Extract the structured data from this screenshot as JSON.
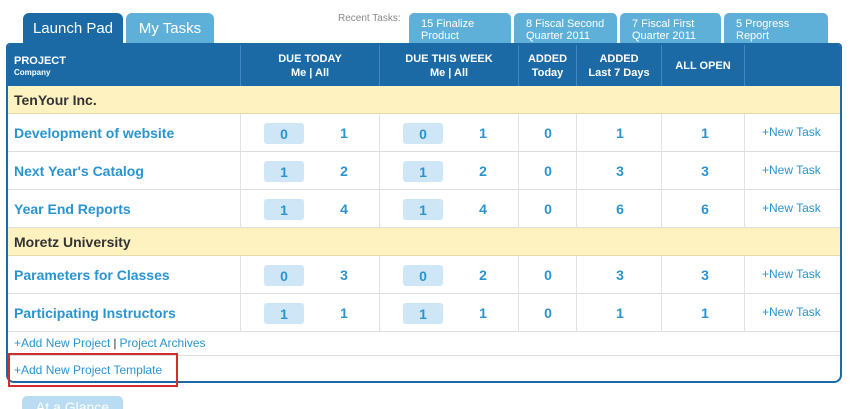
{
  "tabs": {
    "launch_pad": "Launch Pad",
    "my_tasks": "My Tasks"
  },
  "recent": {
    "label": "Recent Tasks:",
    "items": [
      {
        "line1": "15 Finalize",
        "line2": "Product"
      },
      {
        "line1": "8 Fiscal Second",
        "line2": "Quarter 2011"
      },
      {
        "line1": "7 Fiscal First",
        "line2": "Quarter 2011"
      },
      {
        "line1": "5 Progress",
        "line2": "Report"
      }
    ]
  },
  "header": {
    "project": "PROJECT",
    "company": "Company",
    "due_today": "DUE TODAY",
    "due_today_sub": "Me | All",
    "due_week": "DUE THIS WEEK",
    "due_week_sub": "Me | All",
    "added": "ADDED",
    "added_sub": "Today",
    "added7": "ADDED",
    "added7_sub": "Last 7 Days",
    "all_open": "ALL OPEN"
  },
  "companies": [
    {
      "name": "TenYour Inc.",
      "projects": [
        {
          "name": "Development of website",
          "today_me": "0",
          "today_all": "1",
          "week_me": "0",
          "week_all": "1",
          "added_today": "0",
          "added_7": "1",
          "all_open": "1",
          "new_task": "+New Task"
        },
        {
          "name": "Next Year's Catalog",
          "today_me": "1",
          "today_all": "2",
          "week_me": "1",
          "week_all": "2",
          "added_today": "0",
          "added_7": "3",
          "all_open": "3",
          "new_task": "+New Task"
        },
        {
          "name": "Year End Reports",
          "today_me": "1",
          "today_all": "4",
          "week_me": "1",
          "week_all": "4",
          "added_today": "0",
          "added_7": "6",
          "all_open": "6",
          "new_task": "+New Task"
        }
      ]
    },
    {
      "name": "Moretz University",
      "projects": [
        {
          "name": "Parameters for Classes",
          "today_me": "0",
          "today_all": "3",
          "week_me": "0",
          "week_all": "2",
          "added_today": "0",
          "added_7": "3",
          "all_open": "3",
          "new_task": "+New Task"
        },
        {
          "name": "Participating Instructors",
          "today_me": "1",
          "today_all": "1",
          "week_me": "1",
          "week_all": "1",
          "added_today": "0",
          "added_7": "1",
          "all_open": "1",
          "new_task": "+New Task"
        }
      ]
    }
  ],
  "footer": {
    "add_project": "+Add New Project",
    "separator": "|",
    "archives": "Project Archives",
    "add_template": "+Add New Project Template"
  },
  "bottom_tab": "At a Glance",
  "colors": {
    "primary": "#1b6aa6",
    "tab_light": "#5fb0d9",
    "link": "#2a94d0",
    "company_bg": "#fdf2c0",
    "highlight": "#d32c2c"
  }
}
